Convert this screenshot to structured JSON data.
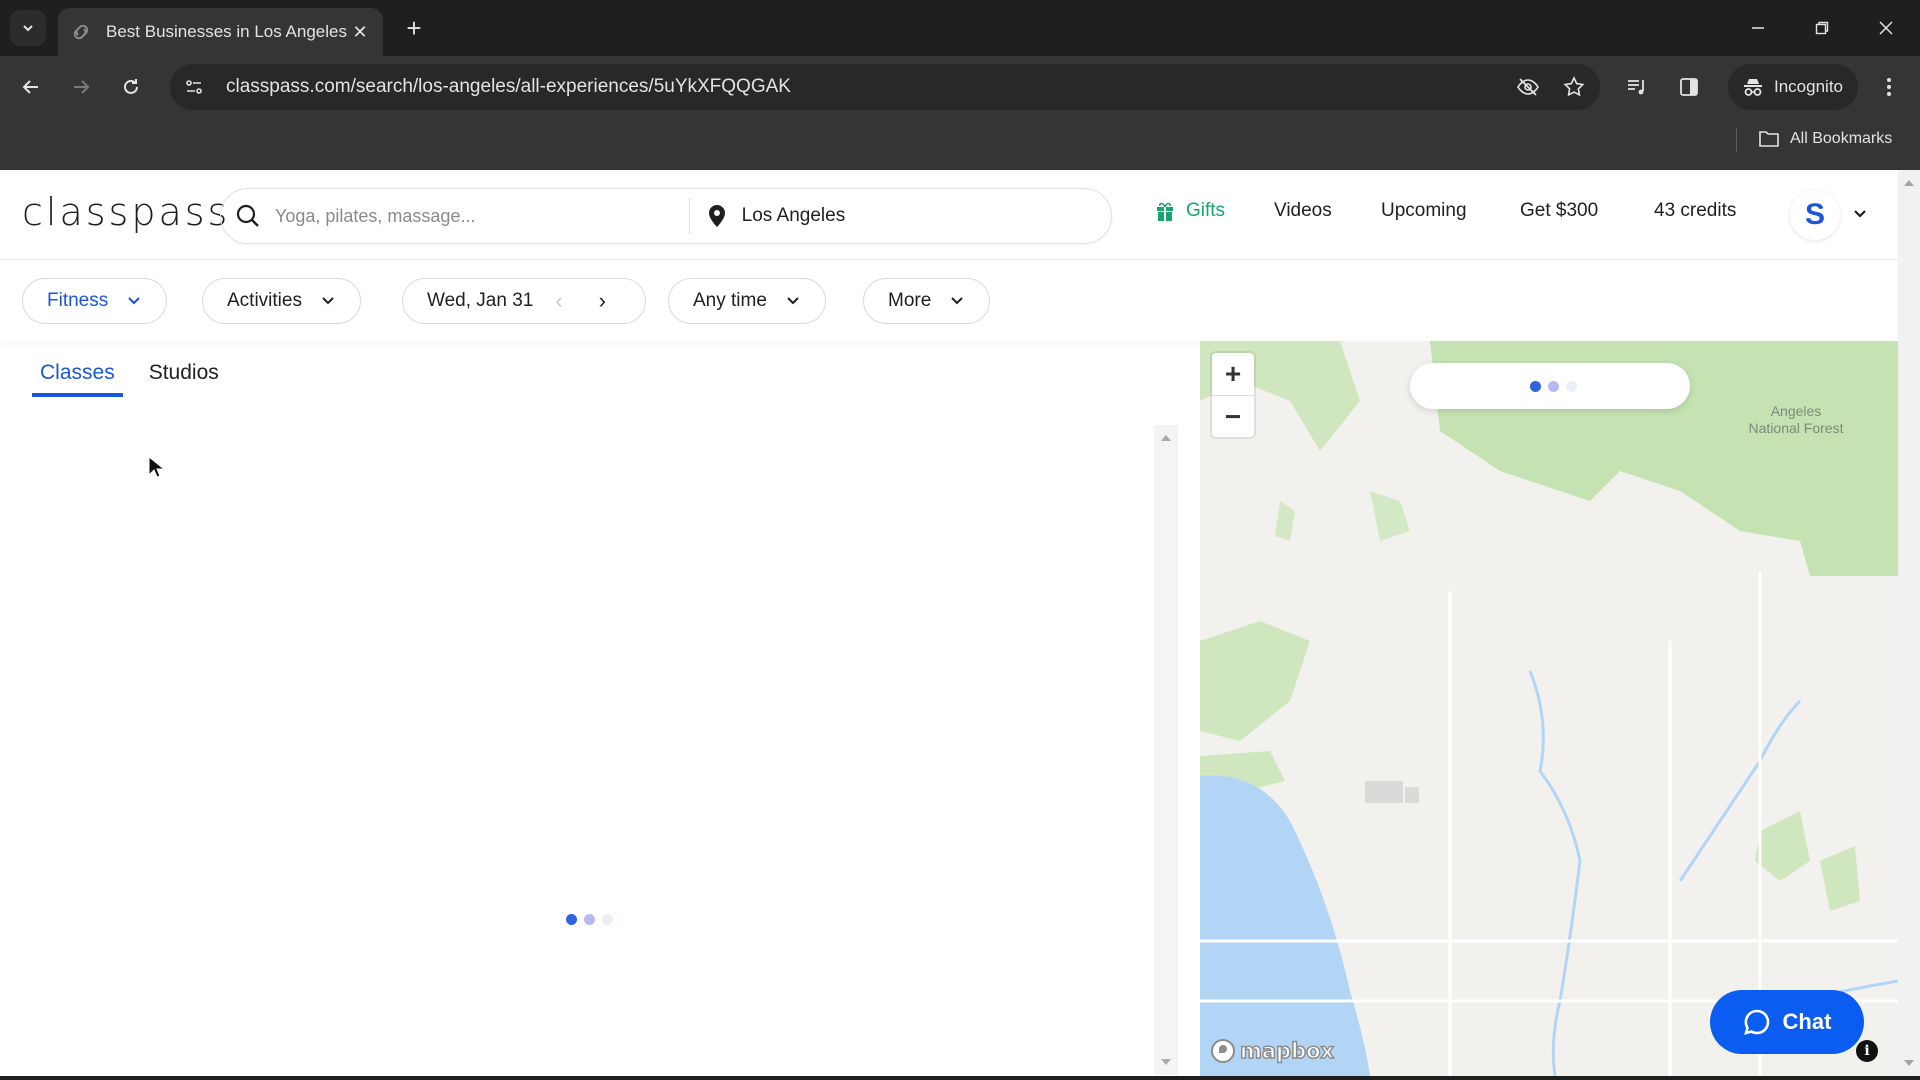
{
  "browser": {
    "tab_title": "Best Businesses in Los Angeles",
    "url": "classpass.com/search/los-angeles/all-experiences/5uYkXFQQGAK",
    "profile_label": "Incognito",
    "bookmarks_label": "All Bookmarks"
  },
  "header": {
    "logo": "classpass",
    "search_placeholder": "Yoga, pilates, massage...",
    "location_value": "Los Angeles",
    "nav": {
      "gifts": "Gifts",
      "videos": "Videos",
      "upcoming": "Upcoming",
      "referral": "Get $300",
      "credits": "43 credits"
    },
    "avatar_initial": "S"
  },
  "filters": {
    "category": "Fitness",
    "activities": "Activities",
    "date": "Wed, Jan 31",
    "time": "Any time",
    "more": "More"
  },
  "results": {
    "tabs": [
      {
        "label": "Classes",
        "active": true
      },
      {
        "label": "Studios",
        "active": false
      }
    ],
    "status": "loading"
  },
  "map": {
    "label_forest": [
      "Angeles",
      "National Forest"
    ],
    "attribution": "mapbox",
    "status": "loading"
  },
  "chat": {
    "label": "Chat"
  },
  "colors": {
    "brand_blue": "#1a56db",
    "gifts_green": "#16a56c",
    "chat_blue": "#0b5cf0"
  }
}
